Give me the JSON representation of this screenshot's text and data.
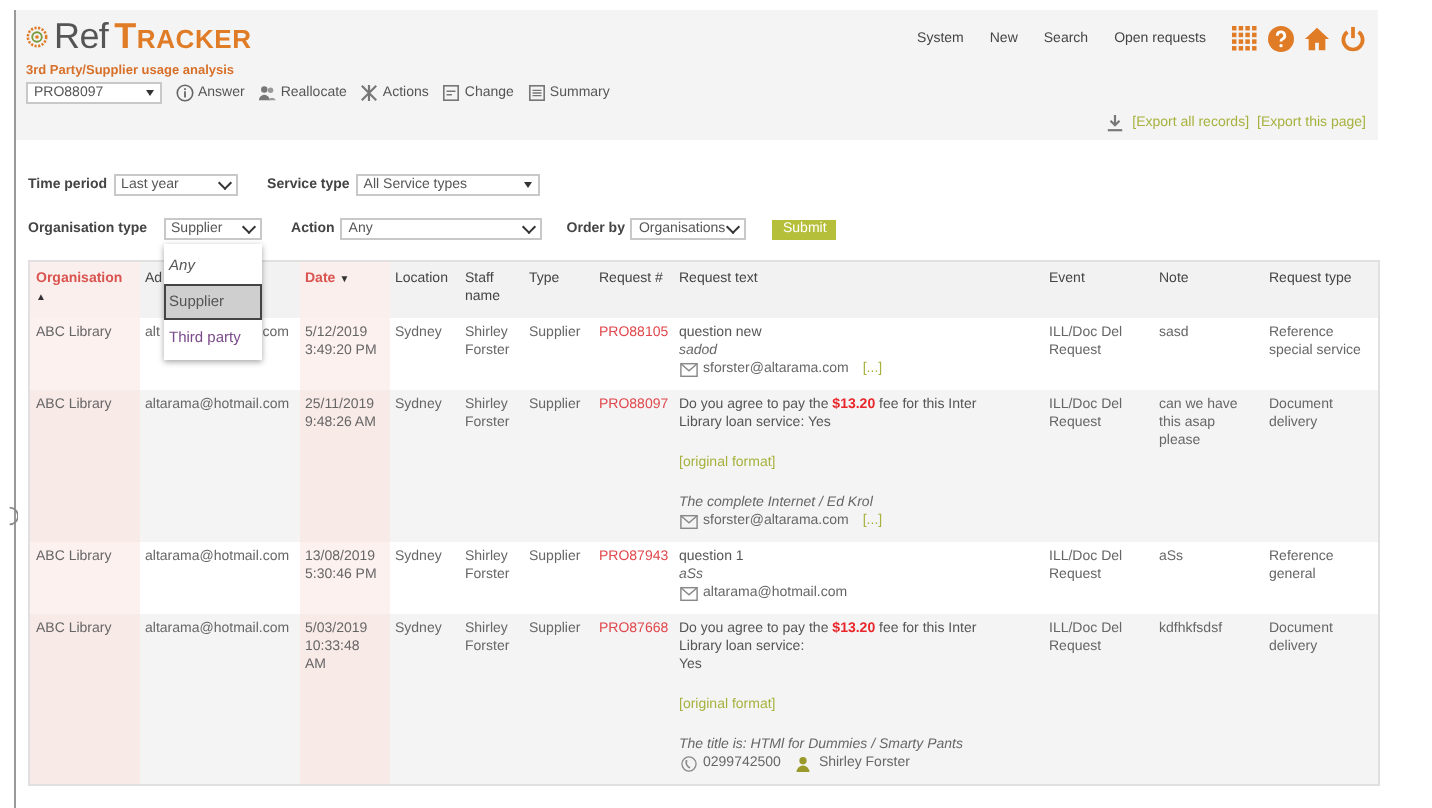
{
  "app": {
    "logo_prefix": "Ref",
    "logo_suffix": "TRACKER",
    "subtitle": "3rd Party/Supplier usage analysis"
  },
  "nav": [
    "System",
    "New",
    "Search",
    "Open requests"
  ],
  "nav_icons": [
    {
      "kind": "grid"
    },
    {
      "kind": "help"
    },
    {
      "kind": "home"
    },
    {
      "kind": "power"
    }
  ],
  "toolbar": {
    "request_select": "PRO88097",
    "actions": [
      {
        "label": "Answer",
        "kind": "info"
      },
      {
        "label": "Reallocate",
        "kind": "people"
      },
      {
        "label": "Actions",
        "kind": "tools"
      },
      {
        "label": "Change",
        "kind": "edit"
      },
      {
        "label": "Summary",
        "kind": "list"
      }
    ]
  },
  "exports": [
    "[Export all records]",
    "[Export this page]"
  ],
  "filters": {
    "time_period": {
      "label": "Time period",
      "value": "Last year"
    },
    "service_type": {
      "label": "Service type",
      "value": "All Service types"
    },
    "organisation_type": {
      "label": "Organisation type",
      "value": "Supplier",
      "options": [
        {
          "label": "Any",
          "selected": false
        },
        {
          "label": "Supplier",
          "selected": true
        },
        {
          "label": "Third party",
          "selected": false
        }
      ]
    },
    "action": {
      "label": "Action",
      "value": "Any"
    },
    "order_by": {
      "label": "Order by",
      "value": "Organisations"
    },
    "submit": "Submit"
  },
  "table": {
    "columns": [
      {
        "label": "Organisation",
        "sorted": true,
        "sort_arrow": "▲"
      },
      {
        "label": "Ad",
        "sorted": false
      },
      {
        "label": "Date",
        "sorted": true,
        "sort_arrow": "▼"
      },
      {
        "label": "Location",
        "sorted": false
      },
      {
        "label": "Staff name",
        "sorted": false
      },
      {
        "label": "Type",
        "sorted": false
      },
      {
        "label": "Request #",
        "sorted": false
      },
      {
        "label": "Request text",
        "sorted": false
      },
      {
        "label": "Event",
        "sorted": false
      },
      {
        "label": "Note",
        "sorted": false
      },
      {
        "label": "Request type",
        "sorted": false
      }
    ],
    "rows": [
      {
        "organisation": "ABC Library",
        "address_parts": [
          "alt",
          "com"
        ],
        "date": "5/12/2019 3:49:20 PM",
        "location": "Sydney",
        "staff": "Shirley Forster",
        "type": "Supplier",
        "request_no": "PRO88105",
        "request": {
          "lines": [
            "question new"
          ],
          "note": "sadod",
          "contact": [
            {
              "kind": "email",
              "text": "sforster@altarama.com"
            },
            {
              "kind": "more",
              "text": "[...]"
            }
          ]
        },
        "event": "ILL/Doc Del Request",
        "note": "sasd",
        "request_type": "Reference special service"
      },
      {
        "organisation": "ABC Library",
        "address": "altarama@hotmail.com",
        "date": "25/11/2019 9:48:26 AM",
        "location": "Sydney",
        "staff": "Shirley Forster",
        "type": "Supplier",
        "request_no": "PRO88097",
        "request": {
          "lines": [
            "Do you agree to pay the **$13.20** fee for this Inter",
            "Library loan service: Yes"
          ],
          "format_link": "[original format]",
          "title": "The complete Internet / Ed Krol",
          "contact": [
            {
              "kind": "email",
              "text": "sforster@altarama.com"
            },
            {
              "kind": "more",
              "text": "[...]"
            }
          ]
        },
        "event": "ILL/Doc Del Request",
        "note": "can we have this asap please",
        "request_type": "Document delivery"
      },
      {
        "organisation": "ABC Library",
        "address": "altarama@hotmail.com",
        "date": "13/08/2019 5:30:46 PM",
        "location": "Sydney",
        "staff": "Shirley Forster",
        "type": "Supplier",
        "request_no": "PRO87943",
        "request": {
          "lines": [
            "question 1"
          ],
          "note": "aSs",
          "contact": [
            {
              "kind": "email",
              "text": "altarama@hotmail.com"
            }
          ]
        },
        "event": "ILL/Doc Del Request",
        "note": "aSs",
        "request_type": "Reference general"
      },
      {
        "organisation": "ABC Library",
        "address": "altarama@hotmail.com",
        "date": "5/03/2019 10:33:48 AM",
        "location": "Sydney",
        "staff": "Shirley Forster",
        "type": "Supplier",
        "request_no": "PRO87668",
        "request": {
          "lines": [
            "Do you agree to pay the **$13.20** fee for this Inter",
            "Library loan service:",
            "Yes"
          ],
          "format_link": "[original format]",
          "title": "The title is: HTMl for Dummies / Smarty Pants",
          "contact": [
            {
              "kind": "phone",
              "text": "0299742500"
            },
            {
              "kind": "person",
              "text": "Shirley Forster"
            }
          ]
        },
        "event": "ILL/Doc Del Request",
        "note": "kdfhkfsdsf",
        "request_type": "Document delivery"
      }
    ]
  }
}
